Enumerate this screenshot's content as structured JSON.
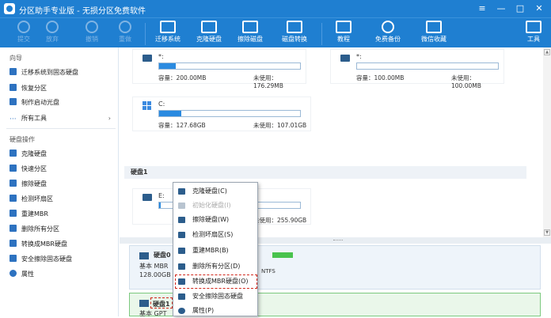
{
  "window": {
    "title": "分区助手专业版 - 无损分区免费软件",
    "controls": [
      "≡",
      "—",
      "□",
      "✕"
    ]
  },
  "toolbar": {
    "left": [
      {
        "label": "提交",
        "icon": "check-icon"
      },
      {
        "label": "放弃",
        "icon": "cancel-icon"
      },
      {
        "label": "撤销",
        "icon": "undo-icon"
      },
      {
        "label": "重做",
        "icon": "redo-icon"
      }
    ],
    "main": [
      {
        "label": "迁移系统",
        "icon": "migrate-icon"
      },
      {
        "label": "克隆硬盘",
        "icon": "clone-disk-icon"
      },
      {
        "label": "擦除磁盘",
        "icon": "wipe-disk-icon"
      },
      {
        "label": "磁盘转换",
        "icon": "convert-disk-icon"
      },
      {
        "label": "教程",
        "icon": "book-icon"
      },
      {
        "label": "免费备份",
        "icon": "backup-icon"
      },
      {
        "label": "微信收藏",
        "icon": "wechat-icon"
      },
      {
        "label": "工具",
        "icon": "toolbox-icon"
      }
    ]
  },
  "sidebar": {
    "wizard_title": "向导",
    "wizard": [
      "迁移系统到固态硬盘",
      "恢复分区",
      "制作启动光盘",
      "所有工具"
    ],
    "disk_title": "硬盘操作",
    "disk_ops": [
      "克隆硬盘",
      "快速分区",
      "擦除硬盘",
      "检测坏扇区",
      "重建MBR",
      "删除所有分区",
      "转换成MBR硬盘",
      "安全擦除固态硬盘",
      "属性"
    ]
  },
  "partitions": [
    {
      "name": "*:",
      "cap_label": "容量：200.00MB",
      "free_label": "未使用：176.29MB",
      "fill": 0.12
    },
    {
      "name": "*:",
      "cap_label": "容量：100.00MB",
      "free_label": "未使用：100.00MB",
      "fill": 0.0
    },
    {
      "name": "C:",
      "cap_label": "容量：127.68GB",
      "free_label": "未使用：107.01GB",
      "fill": 0.16
    }
  ],
  "disk1": {
    "header": "硬盘1",
    "part_name": "E:",
    "part_free": "未使用：255.90GB",
    "part_fill": 0.01
  },
  "disklist": {
    "disk0_name": "硬盘0",
    "disk0_type": "基本 MBR",
    "disk0_size": "128.00GB",
    "disk0_fs": "NTFS",
    "disk1_name": "硬盘1",
    "disk1_type": "基本 GPT"
  },
  "context_menu": [
    {
      "label": "克隆硬盘(C)",
      "enabled": true
    },
    {
      "label": "初始化硬盘(I)",
      "enabled": false
    },
    {
      "label": "擦除硬盘(W)",
      "enabled": true
    },
    {
      "label": "检测坏扇区(S)",
      "enabled": true
    },
    {
      "label": "重建MBR(B)",
      "enabled": true
    },
    {
      "label": "删除所有分区(D)",
      "enabled": true
    },
    {
      "label": "转换成MBR硬盘(O)",
      "enabled": true,
      "highlighted": true
    },
    {
      "label": "安全擦除固态硬盘",
      "enabled": true
    },
    {
      "label": "属性(P)",
      "enabled": true
    }
  ]
}
